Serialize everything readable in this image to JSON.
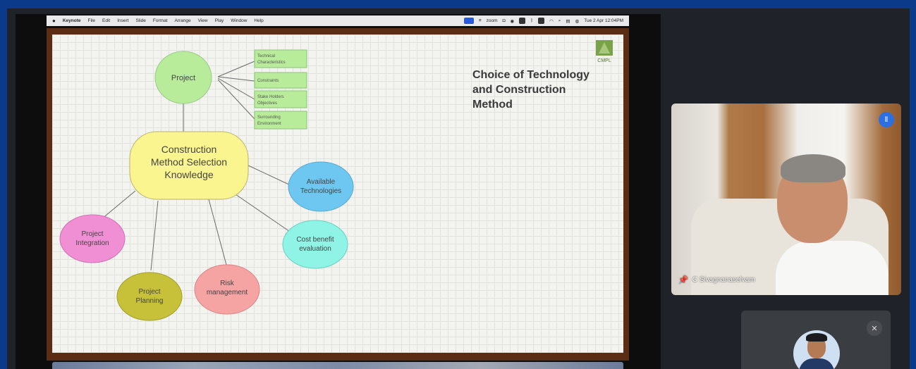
{
  "menubar": {
    "app": "Keynote",
    "items": [
      "File",
      "Edit",
      "Insert",
      "Slide",
      "Format",
      "Arrange",
      "View",
      "Play",
      "Window",
      "Help"
    ],
    "zoom_label": "zoom",
    "clock": "Tue 2 Apr 12:04PM"
  },
  "slide": {
    "title_lines": [
      "Choice of Technology",
      "and Construction",
      "Method"
    ],
    "logo_text": "CMPL",
    "nodes": {
      "project": "Project",
      "central": [
        "Construction",
        "Method Selection",
        "Knowledge"
      ],
      "available": [
        "Available",
        "Technologies"
      ],
      "cost": [
        "Cost benefit",
        "evaluation"
      ],
      "risk": [
        "Risk",
        "management"
      ],
      "planning": [
        "Project",
        "Planning"
      ],
      "integration": [
        "Project",
        "Integration"
      ]
    },
    "boxes": [
      [
        "Technical",
        "Characteristics"
      ],
      [
        "Constraints"
      ],
      [
        "Stake Holders",
        "Objectives"
      ],
      [
        "Surrounding",
        "Environment"
      ]
    ],
    "colors": {
      "project": "#b8ec9a",
      "central": "#fbf58f",
      "available": "#6ec7f0",
      "cost": "#8ff3e6",
      "risk": "#f5a3a3",
      "planning": "#c7c13a",
      "integration": "#f08fd4",
      "box": "#b8ec9a"
    }
  },
  "participants": [
    {
      "name": "C Sivagnanaselvam",
      "speaking_icon": "speaking-indicator-icon",
      "pinned": true
    },
    {
      "name": "",
      "muted": true
    }
  ]
}
